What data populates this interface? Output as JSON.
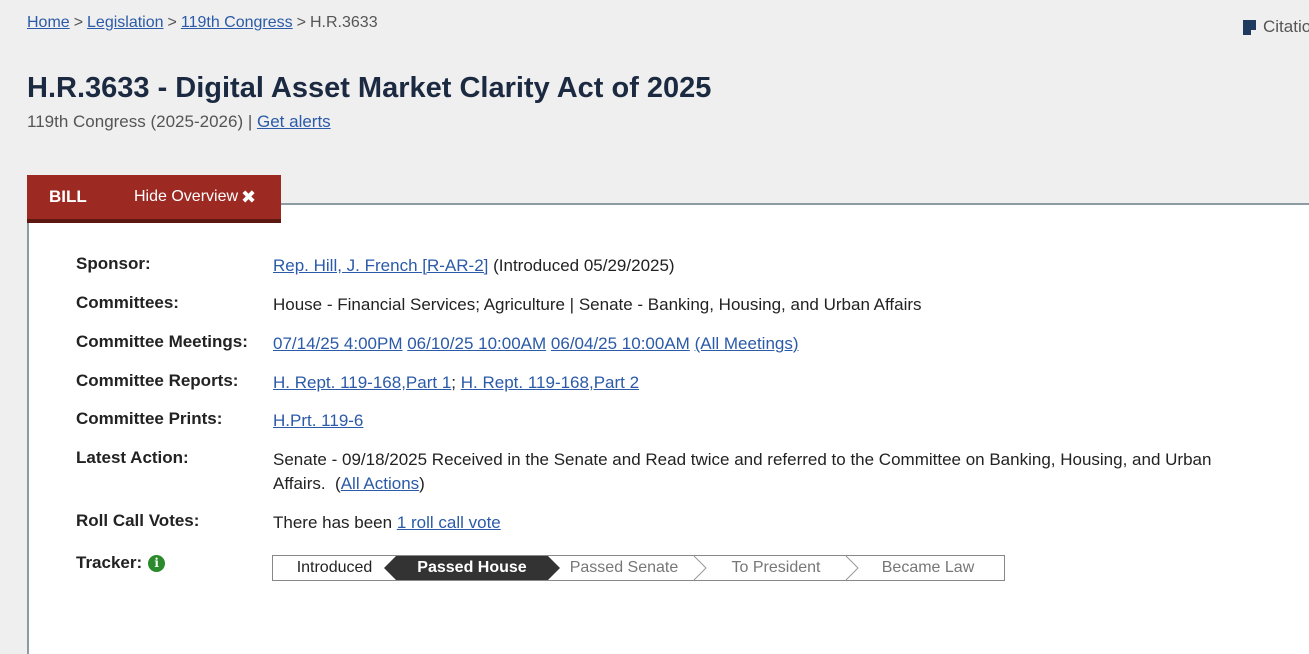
{
  "breadcrumb": {
    "home": "Home",
    "legislation": "Legislation",
    "congress": "119th Congress",
    "sep": ">",
    "current": "H.R.3633"
  },
  "citation_label": "Citation",
  "title": "H.R.3633 - Digital Asset Market Clarity Act of 2025",
  "subtitle": {
    "congress": "119th Congress (2025-2026) |",
    "alerts": "Get alerts"
  },
  "tabs": {
    "bill": "BILL",
    "hide_overview": "Hide Overview"
  },
  "overview": {
    "sponsor": {
      "label": "Sponsor:",
      "link": "Rep. Hill, J. French [R-AR-2]",
      "text": "(Introduced 05/29/2025)"
    },
    "committees": {
      "label": "Committees:",
      "text": "House - Financial Services; Agriculture | Senate - Banking, Housing, and Urban Affairs"
    },
    "meetings": {
      "label": "Committee Meetings:",
      "m1": "07/14/25 4:00PM",
      "m2": "06/10/25 10:00AM",
      "m3": "06/04/25 10:00AM",
      "all": "(All Meetings)"
    },
    "reports": {
      "label": "Committee Reports:",
      "r1": "H. Rept. 119-168,Part 1",
      "sep": ";",
      "r2": "H. Rept. 119-168,Part 2"
    },
    "prints": {
      "label": "Committee Prints:",
      "p1": "H.Prt. 119-6"
    },
    "latest_action": {
      "label": "Latest Action:",
      "text": "Senate - 09/18/2025 Received in the Senate and Read twice and referred to the Committee on Banking, Housing, and Urban Affairs.",
      "open": "(",
      "all_actions": "All Actions",
      "close": ")"
    },
    "roll_call": {
      "label": "Roll Call Votes:",
      "text": "There has been",
      "link": "1 roll call vote"
    },
    "tracker": {
      "label": "Tracker:",
      "steps": [
        "Introduced",
        "Passed House",
        "Passed Senate",
        "To President",
        "Became Law"
      ],
      "current_step": "Passed House"
    }
  },
  "colors": {
    "tab_bg": "#9d2a22",
    "link": "#2b5aa8",
    "title": "#1b2a41",
    "tracker_active": "#333333",
    "info_icon": "#2b8a2b"
  }
}
